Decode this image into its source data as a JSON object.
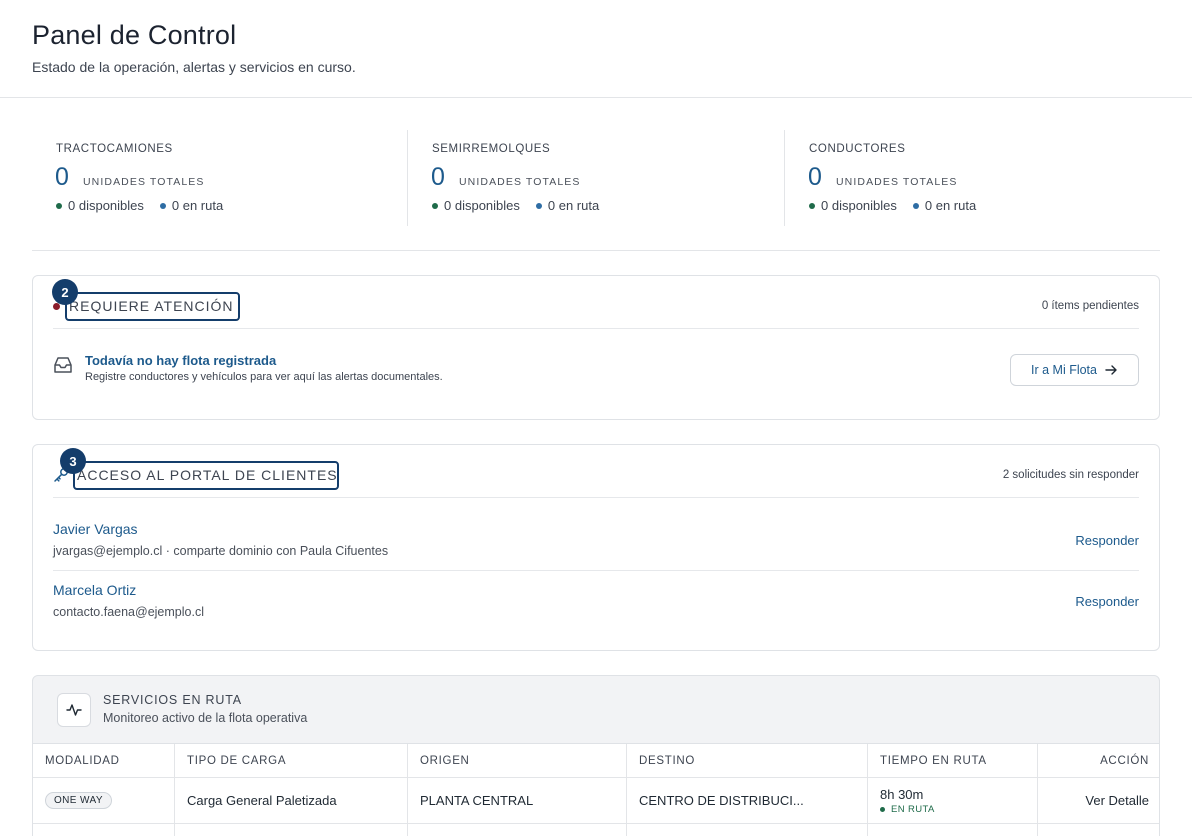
{
  "header": {
    "title": "Panel de Control",
    "subtitle": "Estado de la operación, alertas y servicios en curso."
  },
  "stats": [
    {
      "label": "TRACTOCAMIONES",
      "value": "0",
      "unit": "UNIDADES TOTALES",
      "available": "0 disponibles",
      "en_route": "0 en ruta"
    },
    {
      "label": "SEMIRREMOLQUES",
      "value": "0",
      "unit": "UNIDADES TOTALES",
      "available": "0 disponibles",
      "en_route": "0 en ruta"
    },
    {
      "label": "CONDUCTORES",
      "value": "0",
      "unit": "UNIDADES TOTALES",
      "available": "0 disponibles",
      "en_route": "0 en ruta"
    }
  ],
  "attention": {
    "badge": "2",
    "title": "REQUIERE ATENCIÓN",
    "count": "0 ítems pendientes",
    "empty_title": "Todavía no hay flota registrada",
    "empty_desc": "Registre conductores y vehículos para ver aquí las alertas documentales.",
    "button_label": "Ir a Mi Flota",
    "button_icon": "arrow-right-icon",
    "empty_icon": "inbox-icon"
  },
  "portal": {
    "badge": "3",
    "title": "ACCESO AL PORTAL DE CLIENTES",
    "count": "2 solicitudes sin responder",
    "icon": "key-icon",
    "requests": [
      {
        "name": "Javier Vargas",
        "email": "jvargas@ejemplo.cl · comparte dominio con Paula Cifuentes",
        "action": "Responder"
      },
      {
        "name": "Marcela Ortiz",
        "email": "contacto.faena@ejemplo.cl",
        "action": "Responder"
      }
    ]
  },
  "services": {
    "title": "SERVICIOS EN RUTA",
    "subtitle": "Monitoreo activo de la flota operativa",
    "icon": "activity-icon",
    "columns": [
      "MODALIDAD",
      "TIPO DE CARGA",
      "ORIGEN",
      "DESTINO",
      "TIEMPO EN RUTA",
      "ACCIÓN"
    ],
    "rows": [
      {
        "mode": "ONE WAY",
        "cargo": "Carga General Paletizada",
        "origin": "PLANTA CENTRAL",
        "destination": "CENTRO DE DISTRIBUCI...",
        "time": "8h 30m",
        "status": "EN RUTA",
        "action": "Ver Detalle"
      }
    ]
  },
  "colors": {
    "accent": "#1d5a8c",
    "focus": "#143d6b",
    "alert": "#8a1c2b",
    "ok": "#1f6b4a"
  }
}
